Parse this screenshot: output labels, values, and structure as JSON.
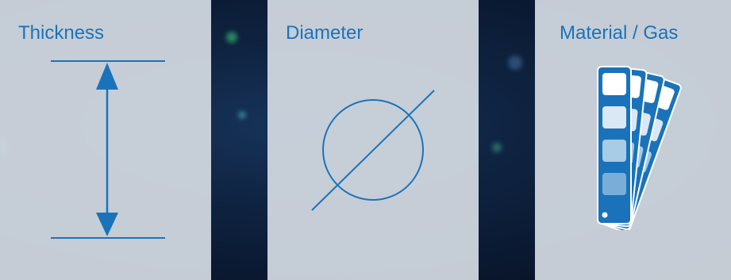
{
  "cards": [
    {
      "title": "Thickness",
      "icon": "thickness-arrow-icon"
    },
    {
      "title": "Diameter",
      "icon": "diameter-symbol-icon"
    },
    {
      "title": "Material / Gas",
      "icon": "color-swatch-fan-icon"
    }
  ],
  "colors": {
    "accent": "#1a73ba",
    "card_background": "#d6dce4",
    "page_background": "#0f2442"
  }
}
